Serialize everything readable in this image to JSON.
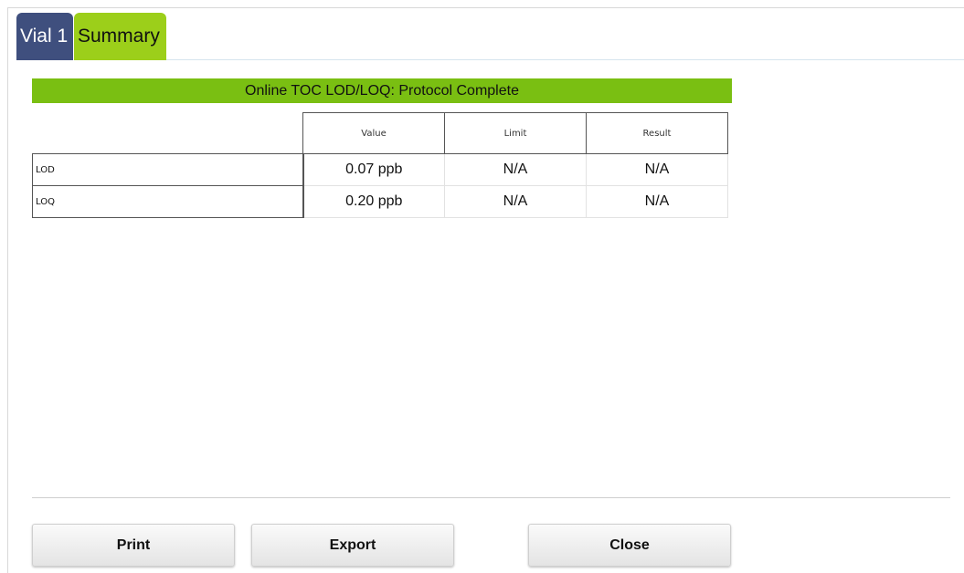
{
  "tabs": [
    {
      "label": "Vial 1"
    },
    {
      "label": "Summary"
    }
  ],
  "banner": "Online TOC LOD/LOQ: Protocol Complete",
  "table": {
    "headers": [
      "Value",
      "Limit",
      "Result"
    ],
    "rows": [
      {
        "name": "LOD",
        "value": "0.07 ppb",
        "limit": "N/A",
        "result": "N/A"
      },
      {
        "name": "LOQ",
        "value": "0.20 ppb",
        "limit": "N/A",
        "result": "N/A"
      }
    ]
  },
  "buttons": {
    "print": "Print",
    "export": "Export",
    "close": "Close"
  },
  "colors": {
    "tab_vial": "#3f4f7e",
    "tab_summary": "#9ccf1a",
    "banner": "#7abf12"
  }
}
